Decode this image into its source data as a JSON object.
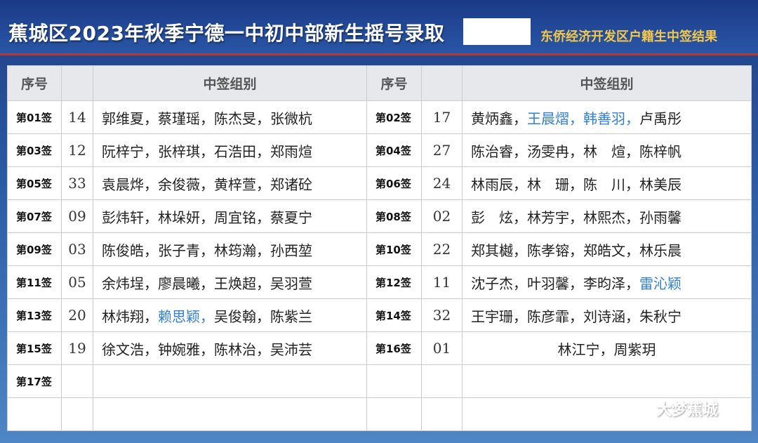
{
  "header": {
    "title": "蕉城区2023年秋季宁德一中初中部新生摇号录取",
    "subtitle": "东侨经济开发区户籍生中签结果"
  },
  "table": {
    "headers": [
      "序号",
      "中签组别",
      "序号",
      "中签组别"
    ],
    "rows": [
      {
        "left_lot": "第01签",
        "left_num": "14",
        "left_names": [
          [
            "郭维夏，蔡瑾瑶，陈杰旻，张微杭",
            false
          ]
        ],
        "right_lot": "第02签",
        "right_num": "17",
        "right_names": [
          [
            "黄炳鑫，",
            false
          ],
          [
            "王晨熠，韩善羽，",
            true
          ],
          [
            "卢禹彤",
            false
          ]
        ]
      },
      {
        "left_lot": "第03签",
        "left_num": "12",
        "left_names": [
          [
            "阮梓宁，张梓琪，石浩田，郑雨煊",
            false
          ]
        ],
        "right_lot": "第04签",
        "right_num": "27",
        "right_names": [
          [
            "陈治睿，汤雯冉，林　煊，陈梓帆",
            false
          ]
        ]
      },
      {
        "left_lot": "第05签",
        "left_num": "33",
        "left_names": [
          [
            "袁晨烨，余俊薇，黄梓萱，郑诸砼",
            false
          ]
        ],
        "right_lot": "第06签",
        "right_num": "24",
        "right_names": [
          [
            "林雨辰，林　珊，陈　川，林美辰",
            false
          ]
        ]
      },
      {
        "left_lot": "第07签",
        "left_num": "09",
        "left_names": [
          [
            "彭炜轩，林垛妍，周宜铭，蔡夏宁",
            false
          ]
        ],
        "right_lot": "第08签",
        "right_num": "02",
        "right_names": [
          [
            "彭　炫，林芳宇，林熙杰，孙雨馨",
            false
          ]
        ]
      },
      {
        "left_lot": "第09签",
        "left_num": "03",
        "left_names": [
          [
            "陈俊皓，张子青，林筠瀚，孙西堃",
            false
          ]
        ],
        "right_lot": "第10签",
        "right_num": "22",
        "right_names": [
          [
            "郑其樾，陈孝镕，郑皓文，林乐晨",
            false
          ]
        ]
      },
      {
        "left_lot": "第11签",
        "left_num": "05",
        "left_names": [
          [
            "余炜埕，廖晨曦，王焕超，吴羽萱",
            false
          ]
        ],
        "right_lot": "第12签",
        "right_num": "11",
        "right_names": [
          [
            "沈子杰，叶羽馨，李昀泽，",
            false
          ],
          [
            "雷沁颖",
            true
          ]
        ]
      },
      {
        "left_lot": "第13签",
        "left_num": "20",
        "left_names": [
          [
            "林炜翔，",
            false
          ],
          [
            "赖思颖，",
            true
          ],
          [
            "吴俊翰，陈紫兰",
            false
          ]
        ],
        "right_lot": "第14签",
        "right_num": "32",
        "right_names": [
          [
            "王宇珊，陈彦霏，刘诗涵，朱秋宁",
            false
          ]
        ]
      },
      {
        "left_lot": "第15签",
        "left_num": "19",
        "left_names": [
          [
            "徐文浩，钟婉雅，陈林治，吴沛芸",
            false
          ]
        ],
        "right_lot": "第16签",
        "right_num": "01",
        "right_names": [
          [
            "林江宁，周紫玥",
            false
          ]
        ]
      },
      {
        "left_lot": "第17签",
        "left_num": "",
        "left_names": [],
        "right_lot": "",
        "right_num": "",
        "right_names": []
      },
      {
        "left_lot": "",
        "left_num": "",
        "left_names": [],
        "right_lot": "",
        "right_num": "",
        "right_names": []
      }
    ]
  },
  "watermark": {
    "text": "大梦蕉城",
    "icon": "wechat-icon"
  },
  "colors": {
    "highlight": "#2f7fd6",
    "subtitle": "#f3c84a",
    "divider": "#b8372e"
  }
}
